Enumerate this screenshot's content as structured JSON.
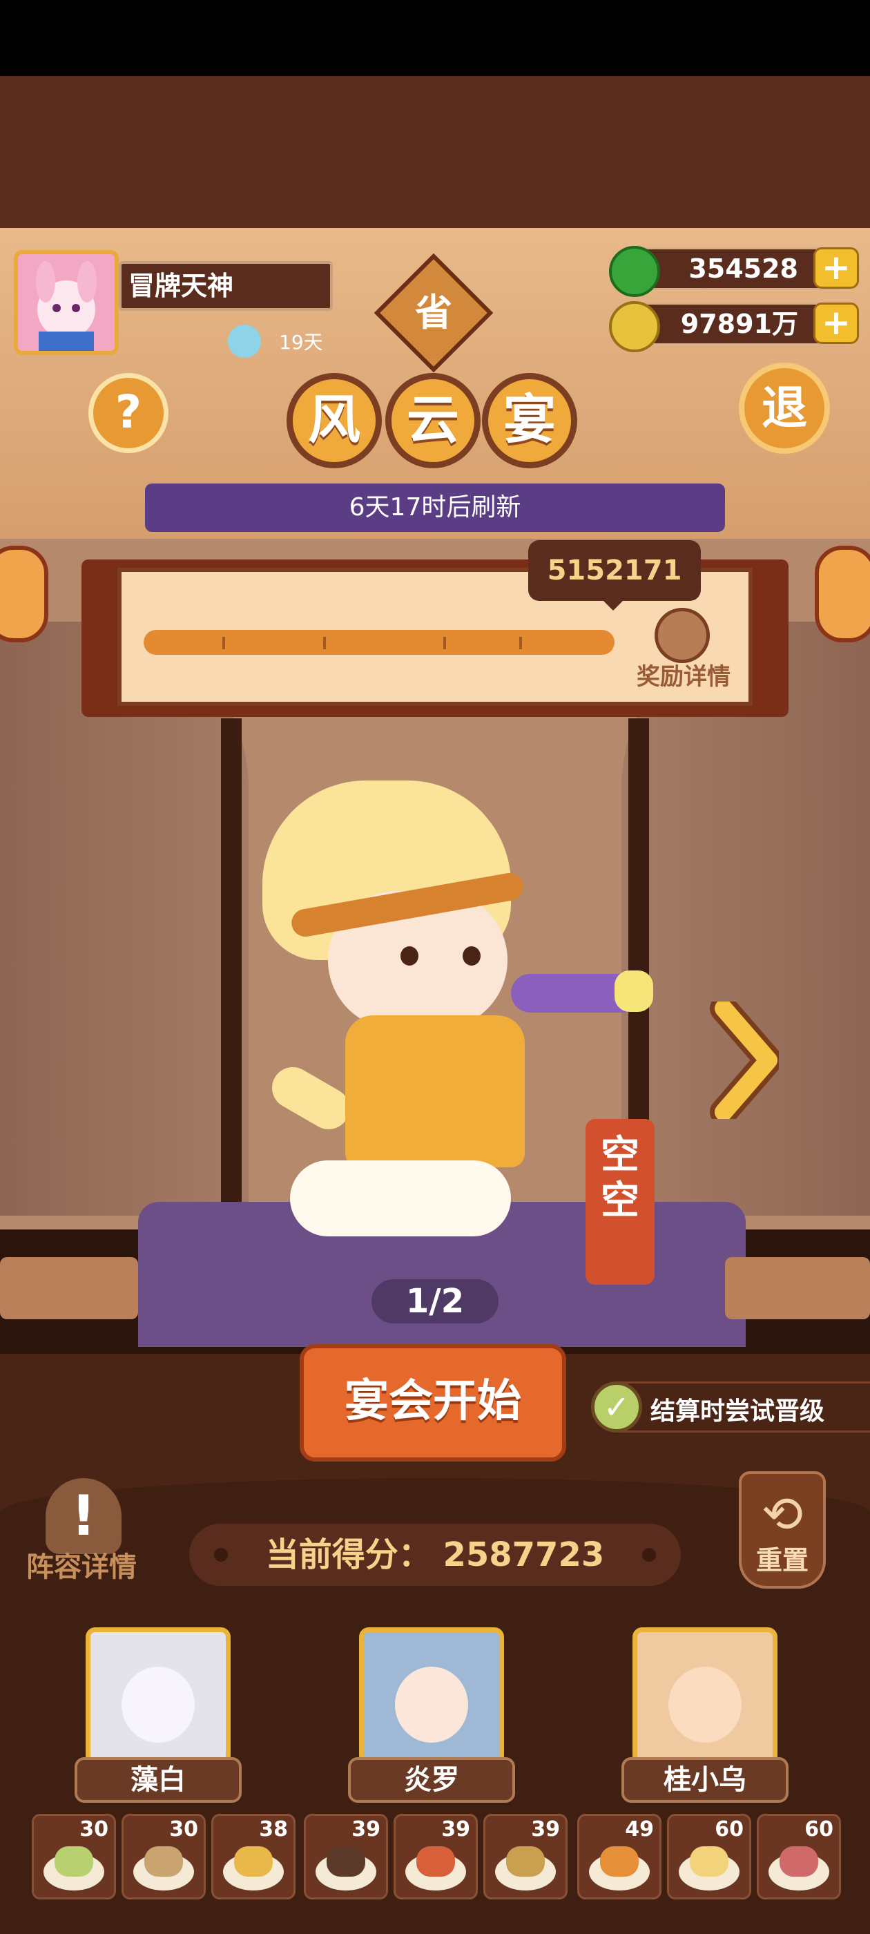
{
  "player": {
    "name": "冒牌天神",
    "days": "19天"
  },
  "province_badge": "省",
  "currencies": {
    "jade": "354528",
    "coins": "97891万",
    "plus": "+"
  },
  "buttons": {
    "help": "?",
    "exit": "退"
  },
  "event": {
    "title_chars": [
      "风",
      "云",
      "宴"
    ],
    "refresh_text": "6天17时后刷新"
  },
  "progress": {
    "target": "5152171",
    "reward_label": "奖励详情"
  },
  "character": {
    "name": "空空",
    "page": "1/2"
  },
  "start_button": "宴会开始",
  "auto_upgrade": {
    "label": "结算时尝试晋级",
    "checked": true
  },
  "lineup_label": "阵容详情",
  "reset_label": "重置",
  "score": {
    "label": "当前得分：",
    "value": "2587723",
    "display": "当前得分：  2587723"
  },
  "heroes": [
    {
      "name": "藻白",
      "color": "#e4e3ea"
    },
    {
      "name": "炎罗",
      "color": "#9fb8d6"
    },
    {
      "name": "桂小乌",
      "color": "#efc9a0"
    }
  ],
  "dishes": [
    {
      "count": "30",
      "food_color": "#b8d070"
    },
    {
      "count": "30",
      "food_color": "#c9a470"
    },
    {
      "count": "38",
      "food_color": "#e9b84a"
    },
    {
      "count": "39",
      "food_color": "#5b3a2a"
    },
    {
      "count": "39",
      "food_color": "#d8603a"
    },
    {
      "count": "39",
      "food_color": "#c8a050"
    },
    {
      "count": "49",
      "food_color": "#e6903a"
    },
    {
      "count": "60",
      "food_color": "#f2d27a"
    },
    {
      "count": "60",
      "food_color": "#d06a6a"
    }
  ],
  "colors": {
    "accent_orange": "#e5682d",
    "gold": "#eab43a",
    "dark_wood": "#5a2c1e"
  }
}
